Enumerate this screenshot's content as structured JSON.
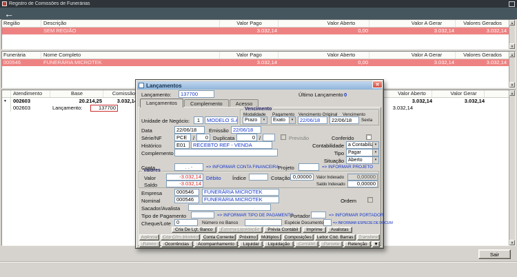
{
  "titlebar": {
    "title": "Registro de Comissões de Funerárias"
  },
  "icons": {
    "back": "←",
    "scroll_up": "▲",
    "scroll_down": "▼",
    "chevron_down": "▾",
    "close": "✕",
    "marker": "▼"
  },
  "columns": {
    "valor_pago": "Valor Pago",
    "valor_aberto": "Valor Aberto",
    "valor_a_gerar": "Valor A Gerar",
    "valores_gerados": "Valores Gerados"
  },
  "regioes": {
    "col_regiao": "Região",
    "col_descricao": "Descrição",
    "row": {
      "descricao": "SEM REGIÃO",
      "valor_pago": "3.032,14",
      "valor_aberto": "0,00",
      "valor_a_gerar": "3.032,14",
      "valores_gerados": "3.032,14"
    }
  },
  "funerarias": {
    "col_funeraria": "Funerária",
    "col_nome": "Nome Completo",
    "row": {
      "codigo": "000546",
      "nome": "FUNERÁRIA MICROTEK",
      "valor_pago": "3.032,14",
      "valor_aberto": "0,00",
      "valor_a_gerar": "3.032,14",
      "valores_gerados": "3.032,14"
    }
  },
  "atendimentos": {
    "col_atendimento": "Atendimento",
    "col_base": "Base",
    "col_comissao": "Comissão",
    "col_valor_aberto": "Valor Aberto",
    "col_valor_gerar": "Valor Gerar",
    "group_row": {
      "atendimento": "002603",
      "base": "20.214,25",
      "comissao": "3.032,14",
      "valor_aberto": "3.032,14",
      "valor_gerar": "3.032,14"
    },
    "detail_row": {
      "atendimento": "002603",
      "descricao": "Lançamento:",
      "lancamento": "137700",
      "valor_aberto": "3.032,14"
    }
  },
  "footer": {
    "sair": "Sair"
  },
  "dialog": {
    "title": "Lançamentos",
    "lancamento_label": "Lançamento:",
    "lancamento": "137700",
    "ultimo_label": "Último Lançamento",
    "ultimo_valor": "0",
    "tabs": {
      "t1": "Lançamentos",
      "t2": "Complemento",
      "t3": "Acesso"
    },
    "unidade": {
      "label": "Unidade de Negócio:",
      "code": "1",
      "name": "MODELO S.A."
    },
    "vencimento_group": {
      "title": "Vencimento",
      "modalidade_label": "Modalidade",
      "modalidade": "Prazo",
      "pagamento_label": "Pagamento",
      "pagamento": "Exato",
      "original_label": "Vencimento Original",
      "original": "22/06/18",
      "vencimento_label": "Vencimento",
      "vencimento": "22/06/18",
      "dia": "Sexta"
    },
    "data": {
      "label": "Data",
      "value": "22/06/18",
      "emissao_label": "Emissão",
      "emissao": "22/06/18"
    },
    "serie": {
      "label": "Série/NF",
      "serie": "PCE",
      "sep": "/",
      "numero": "0",
      "duplicata_label": "Duplicata",
      "duplicata": "0",
      "parcela": "",
      "previsao_label": "Previsão",
      "conferido_label": "Conferido"
    },
    "historico": {
      "label": "Histórico",
      "code": "E01",
      "desc": "RECEBTO REF - VENDA"
    },
    "contabilidade": {
      "label": "Contabilidade",
      "value": "a Contabilizar"
    },
    "complemento": {
      "label": "Complemento",
      "value": ""
    },
    "tipo": {
      "label": "Tipo",
      "value": "Pagar"
    },
    "situacao": {
      "label": "Situação",
      "value": "Aberto"
    },
    "conta": {
      "label": "Conta",
      "value": ". . -",
      "hint": "=> INFORMAR CONTA FINANCEIRA",
      "projeto_label": "Projeto",
      "projeto": "",
      "projeto_hint": "=> INFORMAR PROJETO"
    },
    "valores": {
      "title": "Valores",
      "valor_label": "Valor",
      "valor": "-3.032,14",
      "natureza": "Débito",
      "indice_label": "Índice",
      "indice": "",
      "cotacao_label": "Cotação",
      "cotacao": "0,00000",
      "valor_indexado_label": "Valor Indexado",
      "valor_indexado": "0,00000",
      "saldo_label": "Saldo",
      "saldo": "-3.032,14",
      "saldo_indexado_label": "Saldo Indexado",
      "saldo_indexado": "0,00000"
    },
    "empresa": {
      "label": "Empresa",
      "code": "000546",
      "name": "FUNERÁRIA MICROTEK"
    },
    "nominal": {
      "label": "Nominal",
      "code": "000546",
      "name": "FUNERÁRIA MICROTEK",
      "ordem_label": "Ordem"
    },
    "sacador": {
      "label": "Sacador/Avalista",
      "value": ""
    },
    "tipo_pagamento": {
      "label": "Tipo de Pagamento",
      "value": "",
      "hint": "=> INFORMAR TIPO DE PAGAMENTO",
      "portador_label": "Portador",
      "portador": "",
      "portador_hint": "=> INFORMAR PORTADOR"
    },
    "cheque": {
      "label": "Cheque/Lote",
      "value": "0",
      "numero_banco_label": "Número no Banco",
      "numero_banco": "",
      "especie_label": "Espécie Documento",
      "especie": "",
      "especie_hint": "=> INFORMAR ESPECIE DE DOCUM"
    },
    "buttons": {
      "row1": [
        {
          "label": "Cria De Lçt. Banco",
          "enabled": true
        },
        {
          "label": "Estorna Liquidação",
          "enabled": false
        },
        {
          "label": "Prévia Contábil",
          "enabled": true
        },
        {
          "label": "Imprime",
          "enabled": true
        },
        {
          "label": "Avalistas",
          "enabled": true
        }
      ],
      "row2": [
        {
          "label": "Agência",
          "enabled": false
        },
        {
          "label": "Cóp Cfm. Modelo",
          "enabled": false
        },
        {
          "label": "Conta Corrente",
          "enabled": true
        },
        {
          "label": "Próximo",
          "enabled": true
        },
        {
          "label": "Múltiplos",
          "enabled": true
        },
        {
          "label": "Composições",
          "enabled": true
        },
        {
          "label": "Leitor Cód. Barras",
          "enabled": true
        },
        {
          "label": "Transfere",
          "enabled": false
        }
      ],
      "row3": [
        {
          "label": "Rateio",
          "enabled": false
        },
        {
          "label": "Ocorrências",
          "enabled": true
        },
        {
          "label": "Acompanhamento",
          "enabled": true
        },
        {
          "label": "Liquidar",
          "enabled": true
        },
        {
          "label": "Liquidação",
          "enabled": true
        },
        {
          "label": "Contábil",
          "enabled": false
        },
        {
          "label": "Parcela",
          "enabled": false
        },
        {
          "label": "Retenção",
          "enabled": true
        }
      ]
    }
  }
}
